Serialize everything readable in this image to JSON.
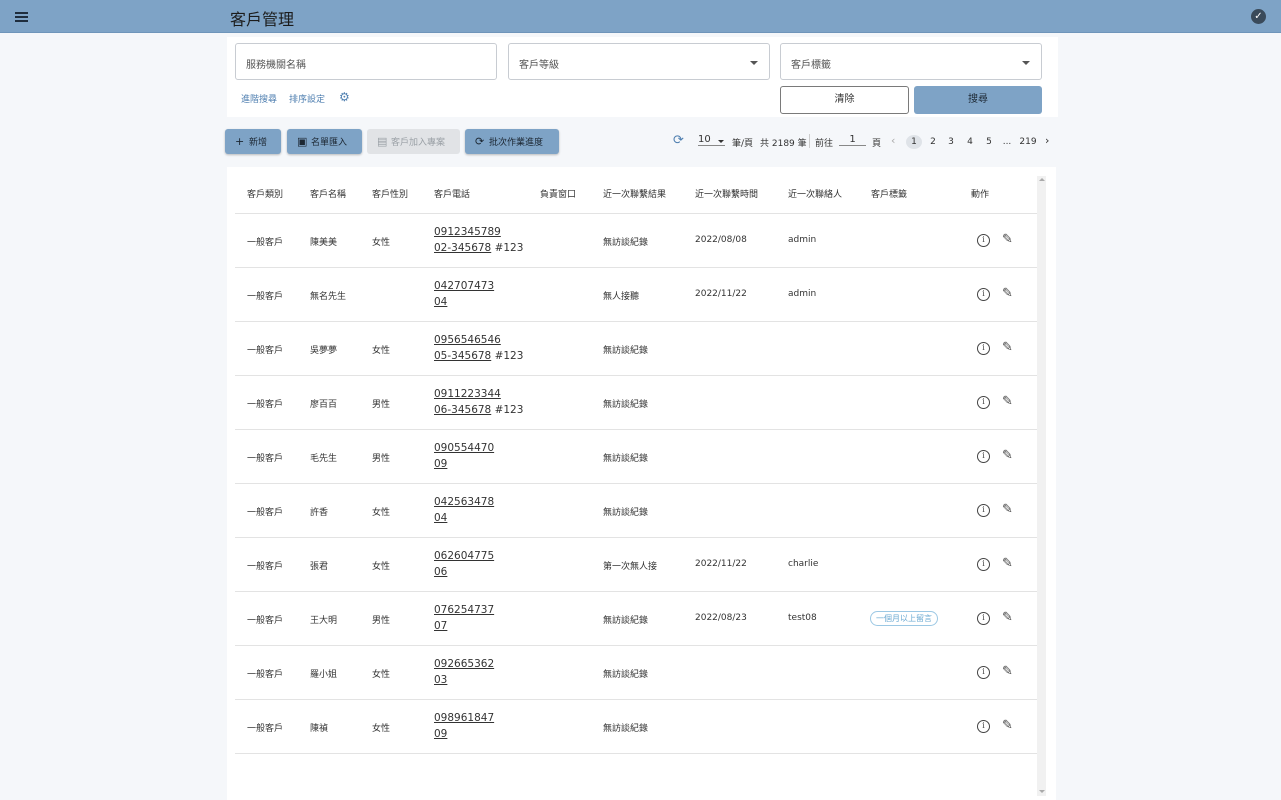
{
  "header": {
    "title": "客戶管理",
    "menu_icon": "menu-icon",
    "status_icon": "check-circle-icon"
  },
  "filters": {
    "agency_placeholder": "服務機關名稱",
    "level_placeholder": "客戶等級",
    "tag_placeholder": "客戶標籤",
    "advanced_search": "進階搜尋",
    "sort_settings": "排序設定",
    "clear_label": "清除",
    "search_label": "搜尋"
  },
  "toolbar": {
    "new_label": "新增",
    "import_label": "名單匯入",
    "add_project_label": "客戶加入專案",
    "batch_label": "批次作業進度"
  },
  "pagination": {
    "page_size": "10",
    "per_page_text": "筆/頁",
    "total_text": "共 2189 筆",
    "goto_label": "前往",
    "goto_value": "1",
    "page_unit": "頁",
    "pages": [
      "1",
      "2",
      "3",
      "4",
      "5",
      "...",
      "219"
    ],
    "current_page": "1"
  },
  "table": {
    "columns": [
      "客戶類別",
      "客戶名稱",
      "客戶性別",
      "客戶電話",
      "負責窗口",
      "近一次聯繫結果",
      "近一次聯繫時間",
      "近一次聯絡人",
      "客戶標籤",
      "動作"
    ],
    "rows": [
      {
        "category": "一般客戶",
        "name": "陳美美",
        "gender": "女性",
        "phone": "0912345789",
        "phone2": "02-345678",
        "ext": " #123",
        "owner": "",
        "result": "無訪談紀錄",
        "time": "2022/08/08",
        "contact": "admin",
        "tag": ""
      },
      {
        "category": "一般客戶",
        "name": "無名先生",
        "gender": "",
        "phone": "042707473",
        "phone2": "04",
        "ext": "",
        "owner": "",
        "result": "無人接聽",
        "time": "2022/11/22",
        "contact": "admin",
        "tag": ""
      },
      {
        "category": "一般客戶",
        "name": "吳夢夢",
        "gender": "女性",
        "phone": "0956546546",
        "phone2": "05-345678",
        "ext": " #123",
        "owner": "",
        "result": "無訪談紀錄",
        "time": "",
        "contact": "",
        "tag": ""
      },
      {
        "category": "一般客戶",
        "name": "廖百百",
        "gender": "男性",
        "phone": "0911223344",
        "phone2": "06-345678",
        "ext": " #123",
        "owner": "",
        "result": "無訪談紀錄",
        "time": "",
        "contact": "",
        "tag": ""
      },
      {
        "category": "一般客戶",
        "name": "毛先生",
        "gender": "男性",
        "phone": "090554470",
        "phone2": "09",
        "ext": "",
        "owner": "",
        "result": "無訪談紀錄",
        "time": "",
        "contact": "",
        "tag": ""
      },
      {
        "category": "一般客戶",
        "name": "許香",
        "gender": "女性",
        "phone": "042563478",
        "phone2": "04",
        "ext": "",
        "owner": "",
        "result": "無訪談紀錄",
        "time": "",
        "contact": "",
        "tag": ""
      },
      {
        "category": "一般客戶",
        "name": "張君",
        "gender": "女性",
        "phone": "062604775",
        "phone2": "06",
        "ext": "",
        "owner": "",
        "result": "第一次無人接",
        "time": "2022/11/22",
        "contact": "charlie",
        "tag": ""
      },
      {
        "category": "一般客戶",
        "name": "王大明",
        "gender": "男性",
        "phone": "076254737",
        "phone2": "07",
        "ext": "",
        "owner": "",
        "result": "無訪談紀錄",
        "time": "2022/08/23",
        "contact": "test08",
        "tag": "一個月以上留言"
      },
      {
        "category": "一般客戶",
        "name": "羅小姐",
        "gender": "女性",
        "phone": "092665362",
        "phone2": "03",
        "ext": "",
        "owner": "",
        "result": "無訪談紀錄",
        "time": "",
        "contact": "",
        "tag": ""
      },
      {
        "category": "一般客戶",
        "name": "陳禎",
        "gender": "女性",
        "phone": "098961847",
        "phone2": "09",
        "ext": "",
        "owner": "",
        "result": "無訪談紀錄",
        "time": "",
        "contact": "",
        "tag": ""
      }
    ]
  },
  "colors": {
    "primary": "#7ea3c6",
    "link": "#4f7fb0",
    "badge": "#6aa9d2"
  }
}
